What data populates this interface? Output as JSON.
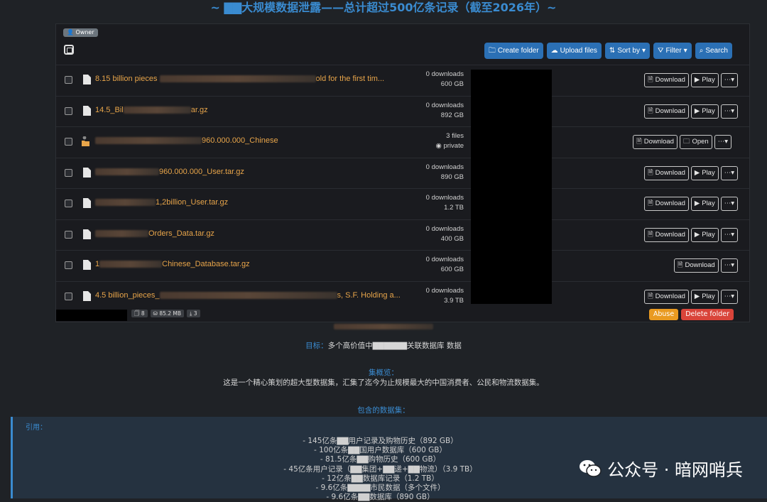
{
  "page_title": "~ ▇▇大规模数据泄露——总计超过500亿条记录（截至2026年）~",
  "owner_badge": "Owner",
  "toolbar": {
    "create_folder": "Create folder",
    "upload_files": "Upload files",
    "sort_by": "Sort by",
    "filter": "Filter",
    "search": "Search"
  },
  "rows": [
    {
      "name_pre": "8.15 billion pieces",
      "name_post": "old for the first tim...",
      "stat1": "0 downloads",
      "stat2": "600 GB",
      "actions": [
        "Download",
        "Play"
      ]
    },
    {
      "name_pre": "14.5_Bil",
      "name_post": "ar.gz",
      "stat1": "0 downloads",
      "stat2": "892 GB",
      "actions": [
        "Download",
        "Play"
      ]
    },
    {
      "name_pre": "",
      "name_post": "960.000.000_Chinese",
      "stat1": "3 files",
      "stat2": "private",
      "actions": [
        "Download",
        "Open"
      ],
      "folder": true
    },
    {
      "name_pre": "",
      "name_post": "960.000.000_User.tar.gz",
      "stat1": "0 downloads",
      "stat2": "890 GB",
      "actions": [
        "Download",
        "Play"
      ]
    },
    {
      "name_pre": "",
      "name_post": "1,2billion_User.tar.gz",
      "stat1": "0 downloads",
      "stat2": "1.2 TB",
      "actions": [
        "Download",
        "Play"
      ]
    },
    {
      "name_pre": "",
      "name_post": "Orders_Data.tar.gz",
      "stat1": "0 downloads",
      "stat2": "400 GB",
      "actions": [
        "Download",
        "Play"
      ]
    },
    {
      "name_pre": "1",
      "name_post": "Chinese_Database.tar.gz",
      "stat1": "0 downloads",
      "stat2": "600 GB",
      "actions": [
        "Download"
      ]
    },
    {
      "name_pre": "4.5 billion_pieces_",
      "name_post": "s, S.F. Holding a...",
      "stat1": "0 downloads",
      "stat2": "3.9 TB",
      "actions": [
        "Download",
        "Play"
      ]
    }
  ],
  "footer": {
    "files": "8",
    "size": "85.2 MB",
    "downloads": "3",
    "abuse": "Abuse",
    "delete_folder": "Delete folder"
  },
  "target": {
    "label": "目标：",
    "text": "多个高价值中▇▇▇▇▇▇关联数据库 数据"
  },
  "overview": {
    "label": "集概览：",
    "text": "这是一个精心策划的超大型数据集，汇集了迄今为止规模最大的中国消费者、公民和物流数据集。"
  },
  "included_label": "包含的数据集：",
  "quote_label": "引用：",
  "datasets": [
    "- 145亿条▇▇用户记录及购物历史（892 GB）",
    "- 100亿条▇▇国用户数据库（600 GB）",
    "- 81.5亿条▇▇购物历史（600 GB）",
    "- 45亿条用户记录（▇▇集团+▇▇递+▇▇物流）（3.9 TB）",
    "- 12亿条▇▇数据库记录（1.2 TB）",
    "- 9.6亿条▇▇▇▇市民数据（多个文件）",
    "- 9.6亿条▇▇数据库（890 GB）"
  ],
  "watermark": "公众号 · 暗网哨兵"
}
